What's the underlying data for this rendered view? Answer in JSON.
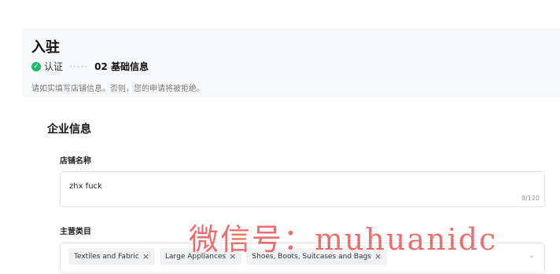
{
  "page": {
    "title": "入驻",
    "steps": {
      "done_label": "认证",
      "separator": "·····",
      "current_label": "02 基础信息"
    },
    "hint": "请如实填写店铺信息。否则，您的申请将被拒绝。"
  },
  "section": {
    "title": "企业信息",
    "store_name": {
      "label": "店铺名称",
      "value": "zhx fuck",
      "counter": "8/120"
    },
    "category": {
      "label": "主营类目",
      "tags": [
        "Textiles and Fabric",
        "Large Appliances",
        "Shoes, Boots, Suitcases and Bags"
      ]
    }
  },
  "watermark": "微信号：muhuanidc",
  "colors": {
    "success": "#1dba6b",
    "watermark": "#e64646"
  },
  "icons": {
    "check": "check-circle-icon",
    "remove": "close-icon",
    "dropdown": "chevron-down-icon"
  }
}
